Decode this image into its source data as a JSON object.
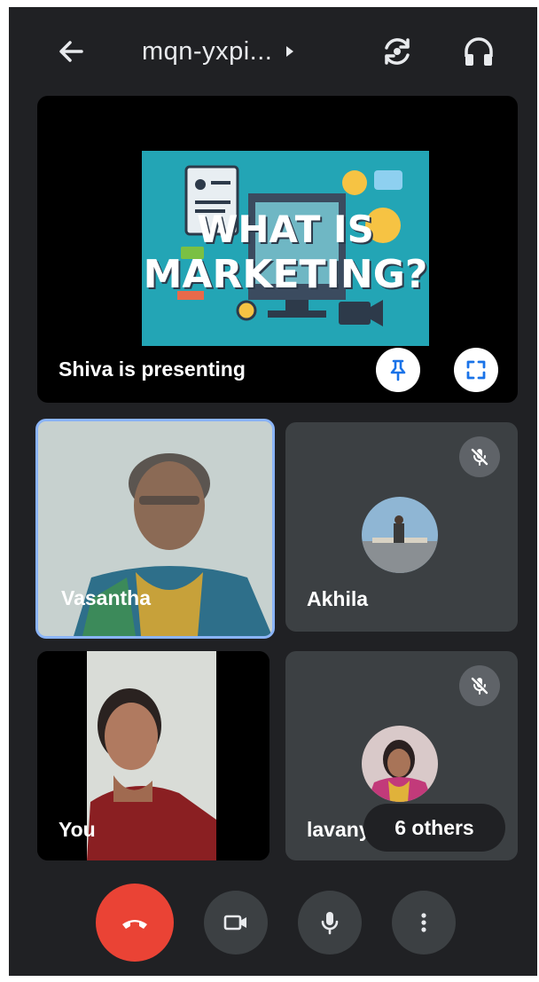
{
  "header": {
    "meeting_code": "mqn-yxpi...",
    "icons": [
      "back-arrow-icon",
      "caret-right-icon",
      "switch-camera-icon",
      "headphones-icon"
    ]
  },
  "presentation": {
    "slide_line1": "WHAT IS",
    "slide_line2": "MARKETING?",
    "presenter_label": "Shiva is presenting",
    "buttons": [
      "pin-icon",
      "fullscreen-icon"
    ]
  },
  "participants": [
    {
      "name": "Vasantha",
      "active_speaker": true,
      "muted": false
    },
    {
      "name": "Akhila",
      "muted": true
    },
    {
      "name": "You",
      "muted": false
    },
    {
      "name": "lavanya",
      "visible_name": "lavany",
      "muted": true
    }
  ],
  "others": {
    "label": "6 others"
  },
  "controls": {
    "icons": [
      "end-call-icon",
      "camera-icon",
      "mic-icon",
      "more-vert-icon"
    ],
    "end_call_color": "#ea4335"
  },
  "colors": {
    "background": "#202124",
    "tile": "#3c4043",
    "active_border": "#8ab4f8"
  }
}
